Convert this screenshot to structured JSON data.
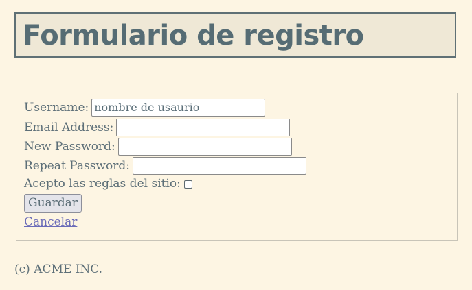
{
  "header": {
    "title": "Formulario de registro"
  },
  "form": {
    "username": {
      "label": "Username:",
      "value": "nombre de usaurio"
    },
    "email": {
      "label": "Email Address:",
      "value": ""
    },
    "new_password": {
      "label": "New Password:",
      "value": ""
    },
    "repeat_password": {
      "label": "Repeat Password:",
      "value": ""
    },
    "accept": {
      "label": "Acepto las reglas del sitio:",
      "checked": false
    },
    "save_label": "Guardar",
    "cancel_label": "Cancelar"
  },
  "footer": {
    "text": "(c) ACME INC."
  }
}
